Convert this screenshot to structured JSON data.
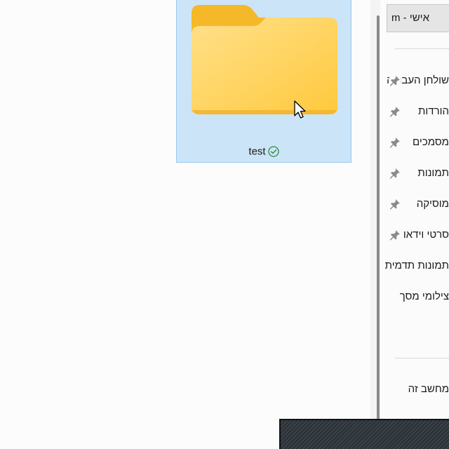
{
  "folder": {
    "name": "test",
    "status_icon": "sync-ok-check-icon",
    "icon": "folder-icon",
    "selected": true,
    "colors": {
      "selection_bg": "#cce4f7",
      "selection_border": "#99c9ef",
      "folder_back": "#f4b829",
      "folder_front": "#ffd562",
      "status_green": "#2f8a3e"
    }
  },
  "nav_pane": {
    "header": "m - אישי",
    "items": [
      {
        "label": "שולחן העבודה",
        "pinned": true
      },
      {
        "label": "הורדות",
        "pinned": true
      },
      {
        "label": "מסמכים",
        "pinned": true
      },
      {
        "label": "תמונות",
        "pinned": true
      },
      {
        "label": "מוסיקה",
        "pinned": true
      },
      {
        "label": "סרטי וידאו",
        "pinned": true
      },
      {
        "label": "תמונות תדמית מ",
        "pinned": false
      },
      {
        "label": "צילומי מסך",
        "pinned": false
      }
    ],
    "this_pc": "מחשב זה"
  },
  "colors": {
    "window_bg": "#fcfcfc",
    "scrollbar_thumb": "#8a8a8a",
    "pin": "#8a8a8a"
  }
}
